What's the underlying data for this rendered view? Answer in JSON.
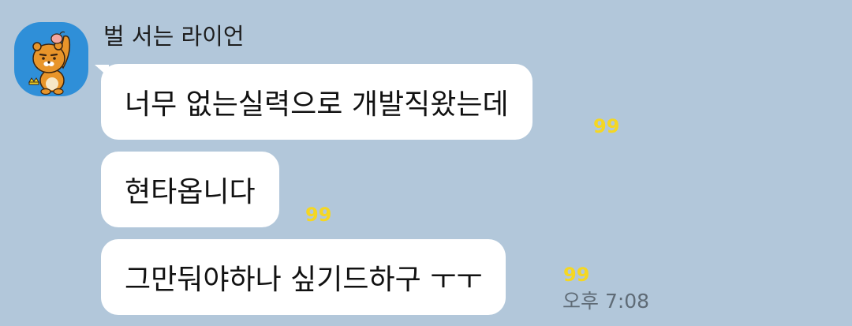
{
  "sender": {
    "name": "벌 서는 라이언",
    "avatar_icon": "ryan-lion-character-icon",
    "avatar_bg": "#2f8fd8"
  },
  "messages": [
    {
      "text": "너무 없는실력으로 개발직왔는데",
      "unread": "99"
    },
    {
      "text": "현타옵니다",
      "unread": "99"
    },
    {
      "text": "그만둬야하나 싶기드하구 ㅜㅜ",
      "unread": "99"
    }
  ],
  "timestamp": "오후 7:08",
  "colors": {
    "background": "#b2c7da",
    "bubble": "#ffffff",
    "unread": "#f5d722",
    "timestamp": "#5f6b76"
  }
}
